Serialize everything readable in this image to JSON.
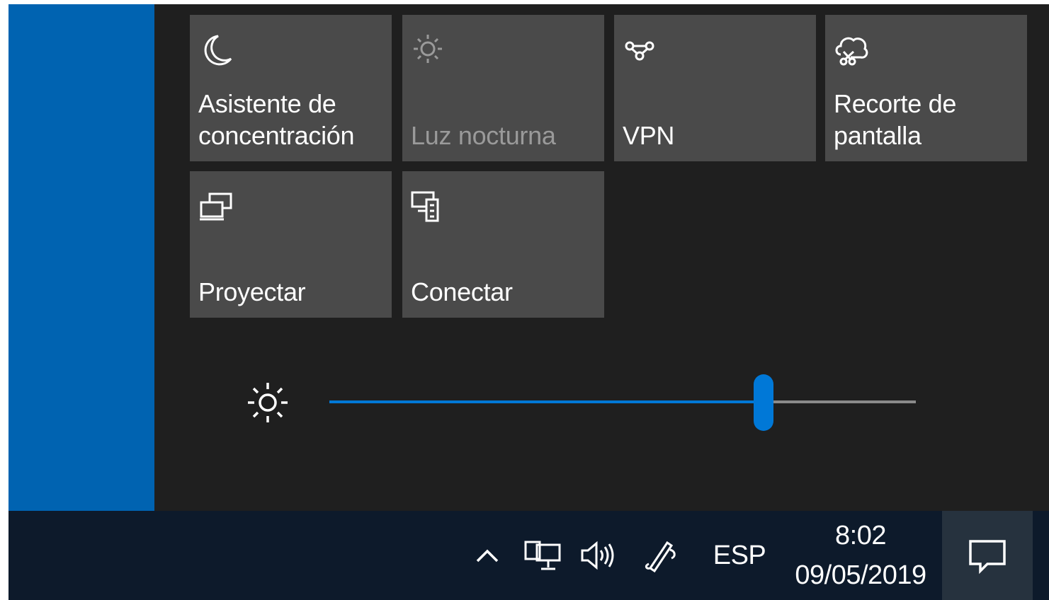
{
  "quick_actions": {
    "tiles": [
      {
        "label": "Asistente de\nconcentración",
        "icon": "moon-icon",
        "state": "enabled"
      },
      {
        "label": "Luz nocturna",
        "icon": "night-light-icon",
        "state": "disabled"
      },
      {
        "label": "VPN",
        "icon": "vpn-icon",
        "state": "enabled"
      },
      {
        "label": "Recorte de\npantalla",
        "icon": "screen-snip-icon",
        "state": "enabled"
      },
      {
        "label": "Proyectar",
        "icon": "project-icon",
        "state": "enabled"
      },
      {
        "label": "Conectar",
        "icon": "connect-icon",
        "state": "enabled"
      }
    ]
  },
  "brightness": {
    "icon": "brightness-icon",
    "value_fraction": 0.74
  },
  "taskbar": {
    "tray_icons": [
      "chevron-up-icon",
      "network-icon",
      "volume-icon",
      "pen-icon"
    ],
    "language": "ESP",
    "time": "8:02",
    "date": "09/05/2019",
    "action_center_icon": "notification-icon"
  },
  "colors": {
    "accent": "#0078d7",
    "panel_bg": "#1f1f1f",
    "tile_bg": "#4a4a4a",
    "taskbar_bg": "#0d1a2b",
    "disabled_text": "#9a9a9a"
  }
}
